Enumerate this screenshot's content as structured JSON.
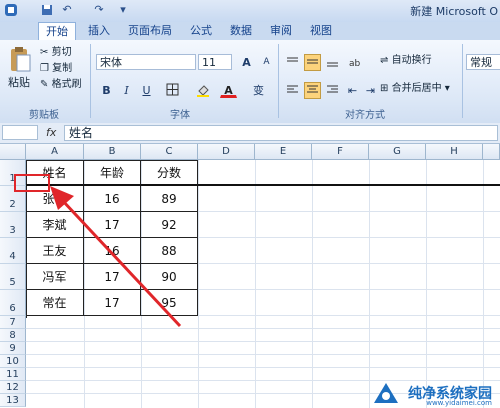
{
  "window": {
    "title": "新建 Microsoft O",
    "quick_access": [
      "save-icon",
      "undo-icon",
      "redo-icon",
      "dropdown-icon"
    ]
  },
  "tabs": [
    {
      "label": "开始",
      "active": true
    },
    {
      "label": "插入"
    },
    {
      "label": "页面布局"
    },
    {
      "label": "公式"
    },
    {
      "label": "数据"
    },
    {
      "label": "审阅"
    },
    {
      "label": "视图"
    }
  ],
  "ribbon": {
    "clipboard": {
      "paste_label": "粘贴",
      "cut_label": "剪切",
      "copy_label": "复制",
      "format_painter_label": "格式刷",
      "group_label": "剪贴板"
    },
    "font": {
      "font_name": "宋体",
      "font_size": "11",
      "grow_label": "A",
      "shrink_label": "A",
      "bold": "B",
      "italic": "I",
      "underline": "U",
      "font_color_label": "A",
      "phonetic_label": "变",
      "group_label": "字体"
    },
    "alignment": {
      "wrap_text_label": "自动换行",
      "merge_center_label": "合并后居中",
      "group_label": "对齐方式"
    },
    "number": {
      "format": "常规"
    }
  },
  "formula_bar": {
    "fx_label": "fx",
    "content": "姓名"
  },
  "sheet": {
    "columns": [
      "A",
      "B",
      "C",
      "D",
      "E",
      "F",
      "G",
      "H"
    ],
    "row_numbers": [
      "1",
      "2",
      "3",
      "4",
      "5",
      "6",
      "7",
      "8",
      "9",
      "10",
      "11",
      "12",
      "13"
    ],
    "table": [
      [
        "姓名",
        "年龄",
        "分数"
      ],
      [
        "张在",
        "16",
        "89"
      ],
      [
        "李斌",
        "17",
        "92"
      ],
      [
        "王友",
        "16",
        "88"
      ],
      [
        "冯军",
        "17",
        "90"
      ],
      [
        "常在",
        "17",
        "95"
      ]
    ]
  },
  "colors": {
    "annotation_red": "#e0262a",
    "watermark_blue": "#1d6fc0"
  },
  "watermark": {
    "name": "纯净系统家园",
    "url": "www.yidaimei.com"
  }
}
